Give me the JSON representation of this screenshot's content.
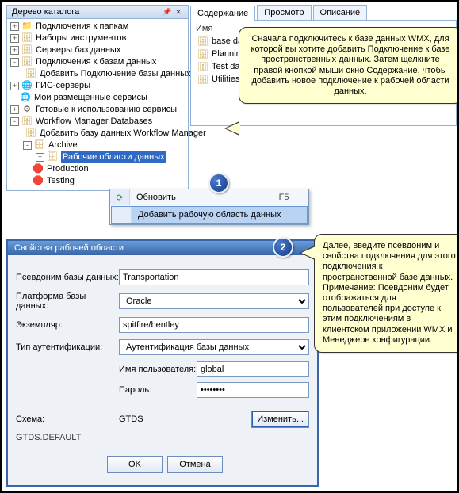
{
  "catalog": {
    "title": "Дерево каталога",
    "items": [
      {
        "toggle": "+",
        "icon": "folder",
        "label": "Подключения к  папкам",
        "depth": 0
      },
      {
        "toggle": "+",
        "icon": "db",
        "label": "Наборы инструментов",
        "depth": 0
      },
      {
        "toggle": "+",
        "icon": "db",
        "label": "Серверы баз данных",
        "depth": 0
      },
      {
        "toggle": "-",
        "icon": "db",
        "label": "Подключения к базам данных",
        "depth": 0
      },
      {
        "toggle": "",
        "icon": "db",
        "label": "Добавить Подключение базы данных",
        "depth": 1
      },
      {
        "toggle": "+",
        "icon": "globe",
        "label": "ГИС-серверы",
        "depth": 0
      },
      {
        "toggle": "",
        "icon": "globe",
        "label": "Мои размещенные сервисы",
        "depth": 0
      },
      {
        "toggle": "+",
        "icon": "gear",
        "label": "Готовые к использованию сервисы",
        "depth": 0
      },
      {
        "toggle": "-",
        "icon": "db",
        "label": "Workflow Manager Databases",
        "depth": 0
      },
      {
        "toggle": "",
        "icon": "db",
        "label": "Добавить базу данных Workflow Manager",
        "depth": 1
      },
      {
        "toggle": "-",
        "icon": "db",
        "label": "Archive",
        "depth": 1
      },
      {
        "toggle": "+",
        "icon": "db",
        "label": "Рабочие области данных",
        "depth": 2,
        "selected": true
      },
      {
        "toggle": "",
        "icon": "red",
        "label": "Production",
        "depth": 1
      },
      {
        "toggle": "",
        "icon": "red",
        "label": "Testing",
        "depth": 1
      }
    ]
  },
  "context_menu": {
    "refresh": "Обновить",
    "refresh_shortcut": "F5",
    "add_workspace": "Добавить рабочую область данных"
  },
  "tabs": {
    "content": "Содержание",
    "preview": "Просмотр",
    "description": "Описание",
    "name_header": "Имя",
    "rows": [
      "base data",
      "Planning",
      "Test data",
      "Utilities"
    ]
  },
  "callouts": {
    "c1": "Сначала подключитесь к базе данных WMX, для которой вы хотите добавить Подключение к базе пространственных данных. Затем щелкните правой кнопкой мыши окно Содержание, чтобы добавить новое подключение к рабочей области данных.",
    "c2": "Далее, введите псевдоним и свойства подключения для этого подключения к пространственной базе данных.\nПримечание: Псевдоним будет отображаться для пользователей при доступе к этим подключениям в клиентском приложении WMX и Менеджере конфигурации."
  },
  "badges": {
    "one": "1",
    "two": "2"
  },
  "dialog": {
    "title": "Свойства рабочей области",
    "alias_label": "Псевдоним базы данных:",
    "alias_value": "Transportation",
    "platform_label": "Платформа базы данных:",
    "platform_value": "Oracle",
    "instance_label": "Экземпляр:",
    "instance_value": "spitfire/bentley",
    "auth_label": "Тип аутентификации:",
    "auth_value": "Аутентификация базы данных",
    "user_label": "Имя пользователя:",
    "user_value": "global",
    "pass_label": "Пароль:",
    "pass_value": "••••••••",
    "schema_label": "Схема:",
    "schema_value": "GTDS",
    "schema_default": "GTDS.DEFAULT",
    "change_btn": "Изменить...",
    "ok_btn": "OK",
    "cancel_btn": "Отмена"
  }
}
